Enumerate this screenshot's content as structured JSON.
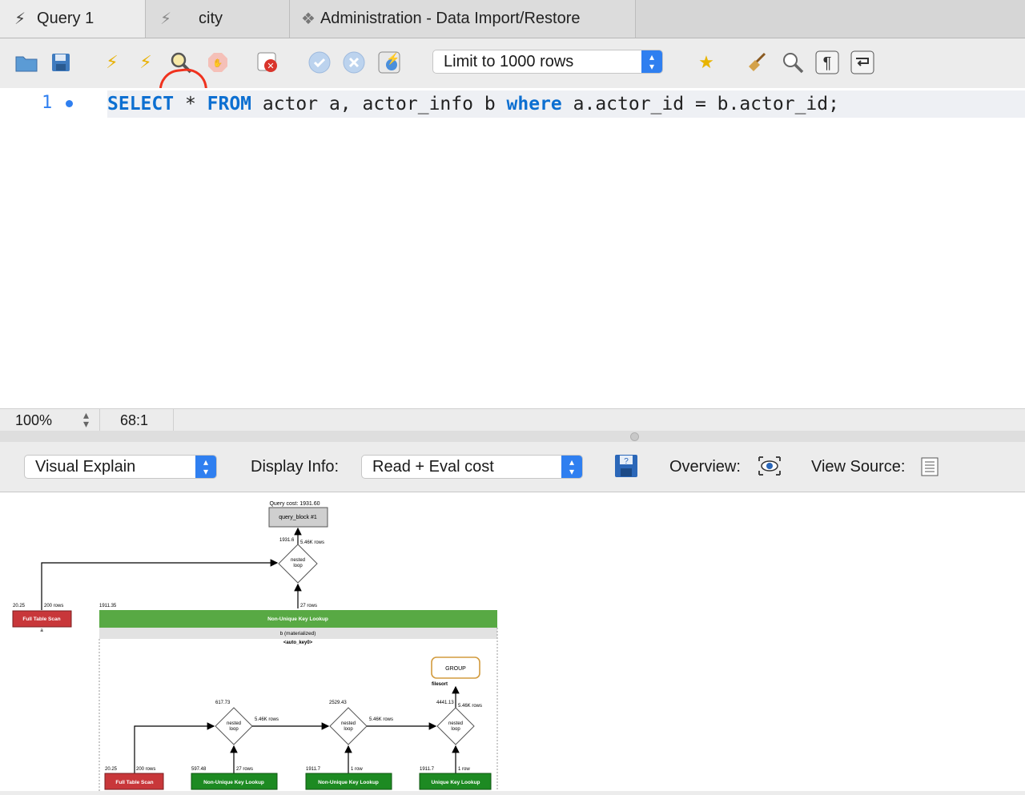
{
  "tabs": [
    {
      "label": "Query 1",
      "icon": "lightning-icon"
    },
    {
      "label": "city",
      "icon": "lightning-icon"
    },
    {
      "label": "Administration - Data Import/Restore",
      "icon": "puzzle-icon"
    }
  ],
  "toolbar": {
    "limit_label": "Limit to 1000 rows",
    "highlight_color": "#f0321e"
  },
  "editor": {
    "line_number": "1",
    "sql": {
      "kw_select": "SELECT",
      "t1": " * ",
      "kw_from": "FROM",
      "t2": " actor a, actor_info b ",
      "kw_where": "where",
      "t3": " a.actor_id = b.actor_id;"
    }
  },
  "status": {
    "zoom": "100%",
    "cursor": "68:1"
  },
  "explain_bar": {
    "mode": "Visual Explain",
    "display_info_label": "Display Info:",
    "display_info_value": "Read + Eval cost",
    "overview_label": "Overview:",
    "view_source_label": "View Source:"
  },
  "diagram": {
    "query_cost": "Query cost: 1931.60",
    "query_block": "query_block #1",
    "top_cost": "1931.6",
    "top_rows": "5.46K rows",
    "nested_loop": "nested loop",
    "scan_a_cost": "20.25",
    "scan_a_rows": "200 rows",
    "scan_a_label": "Full Table Scan",
    "scan_a_table": "a",
    "lookup_cost": "1911.35",
    "lookup_rows": "27 rows",
    "lookup_label": "Non-Unique Key Lookup",
    "lookup_table": "b (materialized)",
    "lookup_key": "<auto_key0>",
    "group_label": "GROUP",
    "filesort_label": "filesort",
    "loop1_cost": "617.73",
    "loop1_rows": "5.46K rows",
    "loop2_cost": "2529.43",
    "loop2_rows": "5.46K rows",
    "loop3_cost": "4441.13",
    "loop3_rows": "5.46K rows",
    "b1_cost": "20.25",
    "b1_rows": "200 rows",
    "b1_label": "Full Table Scan",
    "b2_cost": "597.48",
    "b2_rows": "27 rows",
    "b2_label": "Non-Unique Key Lookup",
    "b3_cost": "1911.7",
    "b3_rows": "1 row",
    "b3_label": "Non-Unique Key Lookup",
    "b4_cost": "1911.7",
    "b4_rows": "1 row",
    "b4_label": "Unique Key Lookup"
  }
}
